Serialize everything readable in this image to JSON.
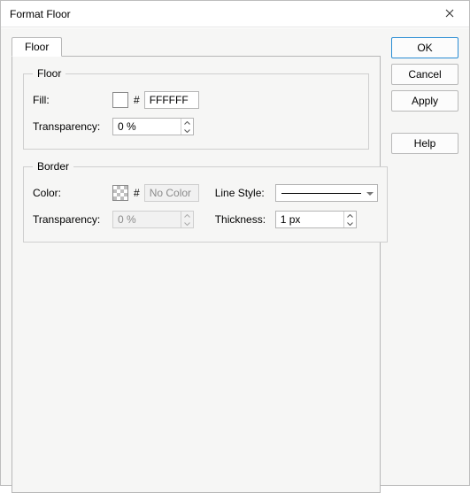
{
  "window": {
    "title": "Format Floor"
  },
  "tabs": {
    "floor": "Floor"
  },
  "groups": {
    "floor": {
      "legend": "Floor",
      "fill_label": "Fill:",
      "fill_hex": "FFFFFF",
      "transparency_label": "Transparency:",
      "transparency_value": "0 %"
    },
    "border": {
      "legend": "Border",
      "color_label": "Color:",
      "color_text": "No Color",
      "transparency_label": "Transparency:",
      "transparency_value": "0 %",
      "linestyle_label": "Line Style:",
      "thickness_label": "Thickness:",
      "thickness_value": "1 px"
    }
  },
  "buttons": {
    "ok": "OK",
    "cancel": "Cancel",
    "apply": "Apply",
    "help": "Help"
  }
}
